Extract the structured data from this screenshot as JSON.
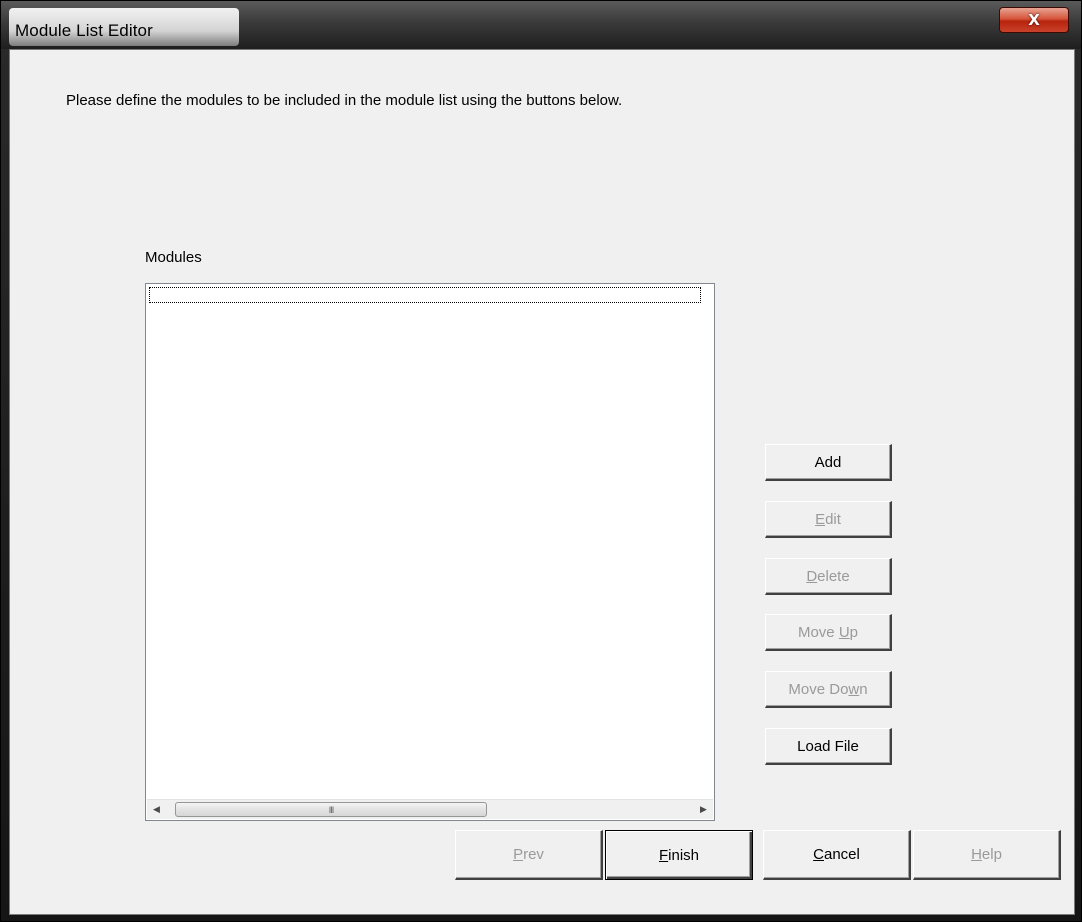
{
  "window": {
    "title": "Module List Editor",
    "close_glyph": "X"
  },
  "content": {
    "instructions": "Please define the modules to be included in the module list using the buttons below.",
    "modules_label": "Modules",
    "modules_items": []
  },
  "scrollbar": {
    "left_arrow": "◀",
    "right_arrow": "▶",
    "thumb_grip": "III"
  },
  "side_buttons": {
    "add": {
      "label": "Add",
      "enabled": true
    },
    "edit": {
      "label": "Edit",
      "enabled": false
    },
    "delete": {
      "label": "Delete",
      "enabled": false
    },
    "move_up": {
      "label": "Move Up",
      "enabled": false
    },
    "move_down": {
      "label": "Move Down",
      "enabled": false
    },
    "load_file": {
      "label": "Load File",
      "enabled": true
    }
  },
  "bottom_buttons": {
    "prev": {
      "label": "Prev",
      "enabled": false
    },
    "finish": {
      "label": "Finish",
      "enabled": true
    },
    "cancel": {
      "label": "Cancel",
      "enabled": true
    },
    "help": {
      "label": "Help",
      "enabled": false
    }
  },
  "icons": {
    "close": "close-icon",
    "scroll_left": "arrow-left-icon",
    "scroll_right": "arrow-right-icon",
    "scroll_grip": "grip-icon"
  },
  "colors": {
    "dialog_background": "#f0f0f0",
    "disabled_text": "#9a9a9a",
    "close_button": "#c9412a"
  }
}
